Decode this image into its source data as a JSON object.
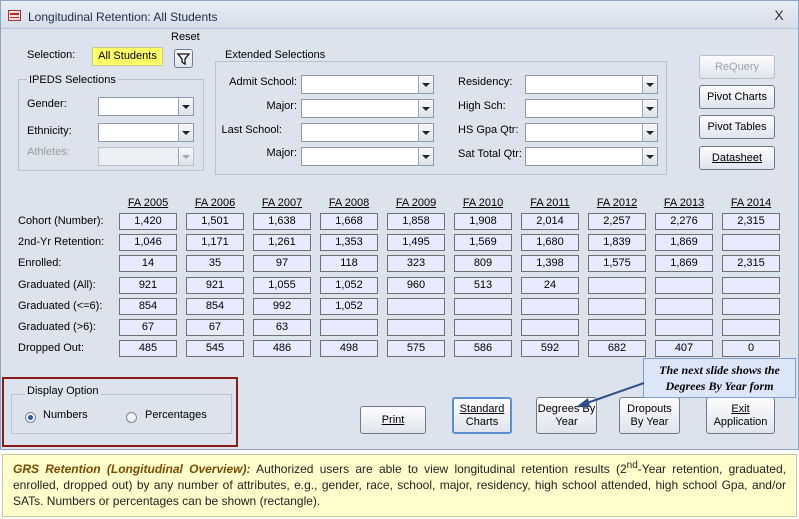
{
  "window": {
    "title": "Longitudinal Retention: All Students",
    "close_glyph": "X"
  },
  "selection": {
    "label": "Selection:",
    "value": "All Students",
    "reset_label": "Reset"
  },
  "ipeds": {
    "heading": "IPEDS Selections",
    "gender_label": "Gender:",
    "gender_value": "",
    "ethnicity_label": "Ethnicity:",
    "ethnicity_value": "",
    "athletes_label": "Athletes:",
    "athletes_value": ""
  },
  "extended": {
    "heading": "Extended Selections",
    "admit_school_label": "Admit School:",
    "major1_label": "Major:",
    "last_school_label": "Last School:",
    "major2_label": "Major:",
    "residency_label": "Residency:",
    "high_sch_label": "High Sch:",
    "hs_gpa_label": "HS Gpa Qtr:",
    "sat_label": "Sat Total Qtr:"
  },
  "side_buttons": {
    "requery": "ReQuery",
    "pivot_charts": "Pivot Charts",
    "pivot_tables": "Pivot Tables",
    "datasheet": "Datasheet"
  },
  "grid": {
    "years": [
      "FA 2005",
      "FA 2006",
      "FA 2007",
      "FA 2008",
      "FA 2009",
      "FA 2010",
      "FA 2011",
      "FA 2012",
      "FA 2013",
      "FA 2014"
    ],
    "rows": [
      {
        "label": "Cohort (Number):",
        "values": [
          "1,420",
          "1,501",
          "1,638",
          "1,668",
          "1,858",
          "1,908",
          "2,014",
          "2,257",
          "2,276",
          "2,315"
        ]
      },
      {
        "label": "2nd-Yr Retention:",
        "values": [
          "1,046",
          "1,171",
          "1,261",
          "1,353",
          "1,495",
          "1,569",
          "1,680",
          "1,839",
          "1,869",
          ""
        ]
      },
      {
        "label": "Enrolled:",
        "values": [
          "14",
          "35",
          "97",
          "118",
          "323",
          "809",
          "1,398",
          "1,575",
          "1,869",
          "2,315"
        ]
      },
      {
        "label": "Graduated (All):",
        "values": [
          "921",
          "921",
          "1,055",
          "1,052",
          "960",
          "513",
          "24",
          "",
          "",
          ""
        ]
      },
      {
        "label": "Graduated (<=6):",
        "values": [
          "854",
          "854",
          "992",
          "1,052",
          "",
          "",
          "",
          "",
          "",
          ""
        ]
      },
      {
        "label": "Graduated (>6):",
        "values": [
          "67",
          "67",
          "63",
          "",
          "",
          "",
          "",
          "",
          "",
          ""
        ]
      },
      {
        "label": "Dropped Out:",
        "values": [
          "485",
          "545",
          "486",
          "498",
          "575",
          "586",
          "592",
          "682",
          "407",
          "0"
        ]
      }
    ]
  },
  "display_option": {
    "heading": "Display Option",
    "numbers_label": "Numbers",
    "percentages_label": "Percentages",
    "selected": "Numbers"
  },
  "bottom_buttons": {
    "print": "Print",
    "standard_charts_1": "Standard",
    "standard_charts_2": "Charts",
    "degrees_1": "Degrees By",
    "degrees_2": "Year",
    "dropouts_1": "Dropouts",
    "dropouts_2": "By Year",
    "exit_1": "Exit",
    "exit_2": "Application"
  },
  "callout": {
    "line1": "The next slide shows the",
    "line2": "Degrees By Year form"
  },
  "caption": {
    "lead": "GRS Retention (Longitudinal Overview):",
    "part1": " Authorized users are able to view longitudinal retention results (2",
    "sup": "nd",
    "part2": "-Year retention, graduated, enrolled, dropped out) by any number of attributes, e.g., gender, race, school, major, residency, high school attended, high school Gpa, and/or SATs.  Numbers or percentages can be shown (rectangle)."
  },
  "colors": {
    "window_bg": "#dde3ec",
    "selection_highlight": "#ffff66",
    "cell_bg": "#e8eaff",
    "rectangle_outline": "#8b1a1a",
    "callout_bg": "#dbe7f8",
    "caption_bg": "#ffffcc"
  }
}
